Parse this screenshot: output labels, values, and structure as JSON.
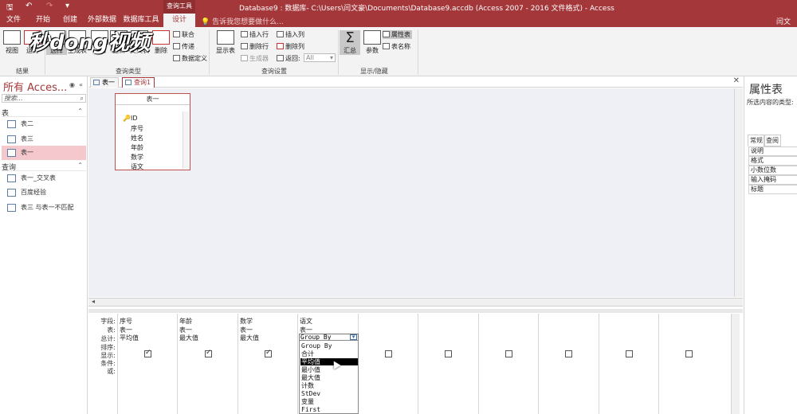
{
  "window": {
    "title": "Database9 : 数据库- C:\\Users\\闫文豪\\Documents\\Database9.accdb (Access 2007 - 2016 文件格式) - Access",
    "context_tab": "查询工具"
  },
  "tabs": [
    "文件",
    "开始",
    "创建",
    "外部数据",
    "数据库工具",
    "设计"
  ],
  "tell_me": "告诉我您想要做什么...",
  "user": "闫文",
  "ribbon": {
    "results": {
      "label": "结果",
      "view": "视图",
      "run": "运行"
    },
    "query_type": {
      "label": "查询类型",
      "select": "选择",
      "make_table": "生成表",
      "append": "追加",
      "update": "更新",
      "crosstab": "交叉表",
      "delete": "删除",
      "union": "联合",
      "pass_through": "传递",
      "data_def": "数据定义"
    },
    "query_setup": {
      "label": "查询设置",
      "show_table": "显示表",
      "insert_rows": "插入行",
      "delete_rows": "删除行",
      "builder": "生成器",
      "insert_cols": "插入列",
      "delete_cols": "删除列",
      "return_label": "返回:",
      "return_value": "All"
    },
    "show_hide": {
      "label": "显示/隐藏",
      "totals": "汇总",
      "params": "参数",
      "property_sheet": "属性表",
      "table_names": "表名称"
    }
  },
  "watermark": "秒懂视频",
  "nav": {
    "header": "所有 Acces...",
    "search": "搜索...",
    "sections": [
      {
        "title": "表",
        "items": [
          "表二",
          "表三",
          "表一"
        ]
      },
      {
        "title": "查询",
        "items": [
          "表一_交叉表",
          "百度经验",
          "表三 与表一不匹配"
        ]
      }
    ]
  },
  "doc_tabs": [
    "表一",
    "查询1"
  ],
  "table_box": {
    "title": "表一",
    "fields": [
      "ID",
      "序号",
      "姓名",
      "年龄",
      "数学",
      "语文"
    ]
  },
  "grid": {
    "row_labels": [
      "字段:",
      "表:",
      "总计:",
      "排序:",
      "显示:",
      "条件:",
      "或:"
    ],
    "columns": [
      {
        "field": "序号",
        "table": "表一",
        "total": "平均值",
        "show": true
      },
      {
        "field": "年龄",
        "table": "表一",
        "total": "最大值",
        "show": true
      },
      {
        "field": "数学",
        "table": "表一",
        "total": "最大值",
        "show": true
      },
      {
        "field": "语文",
        "table": "表一",
        "total": "Group By",
        "show": true
      }
    ],
    "empty_columns": 6,
    "dropdown": [
      "Group By",
      "合计",
      "平均值",
      "最小值",
      "最大值",
      "计数",
      "StDev",
      "变量",
      "First"
    ],
    "dropdown_highlight": 2
  },
  "props": {
    "title": "属性表",
    "subtitle": "所选内容的类型:",
    "tabs": [
      "常规",
      "查阅"
    ],
    "rows": [
      "说明",
      "格式",
      "小数位数",
      "输入掩码",
      "标题"
    ]
  }
}
